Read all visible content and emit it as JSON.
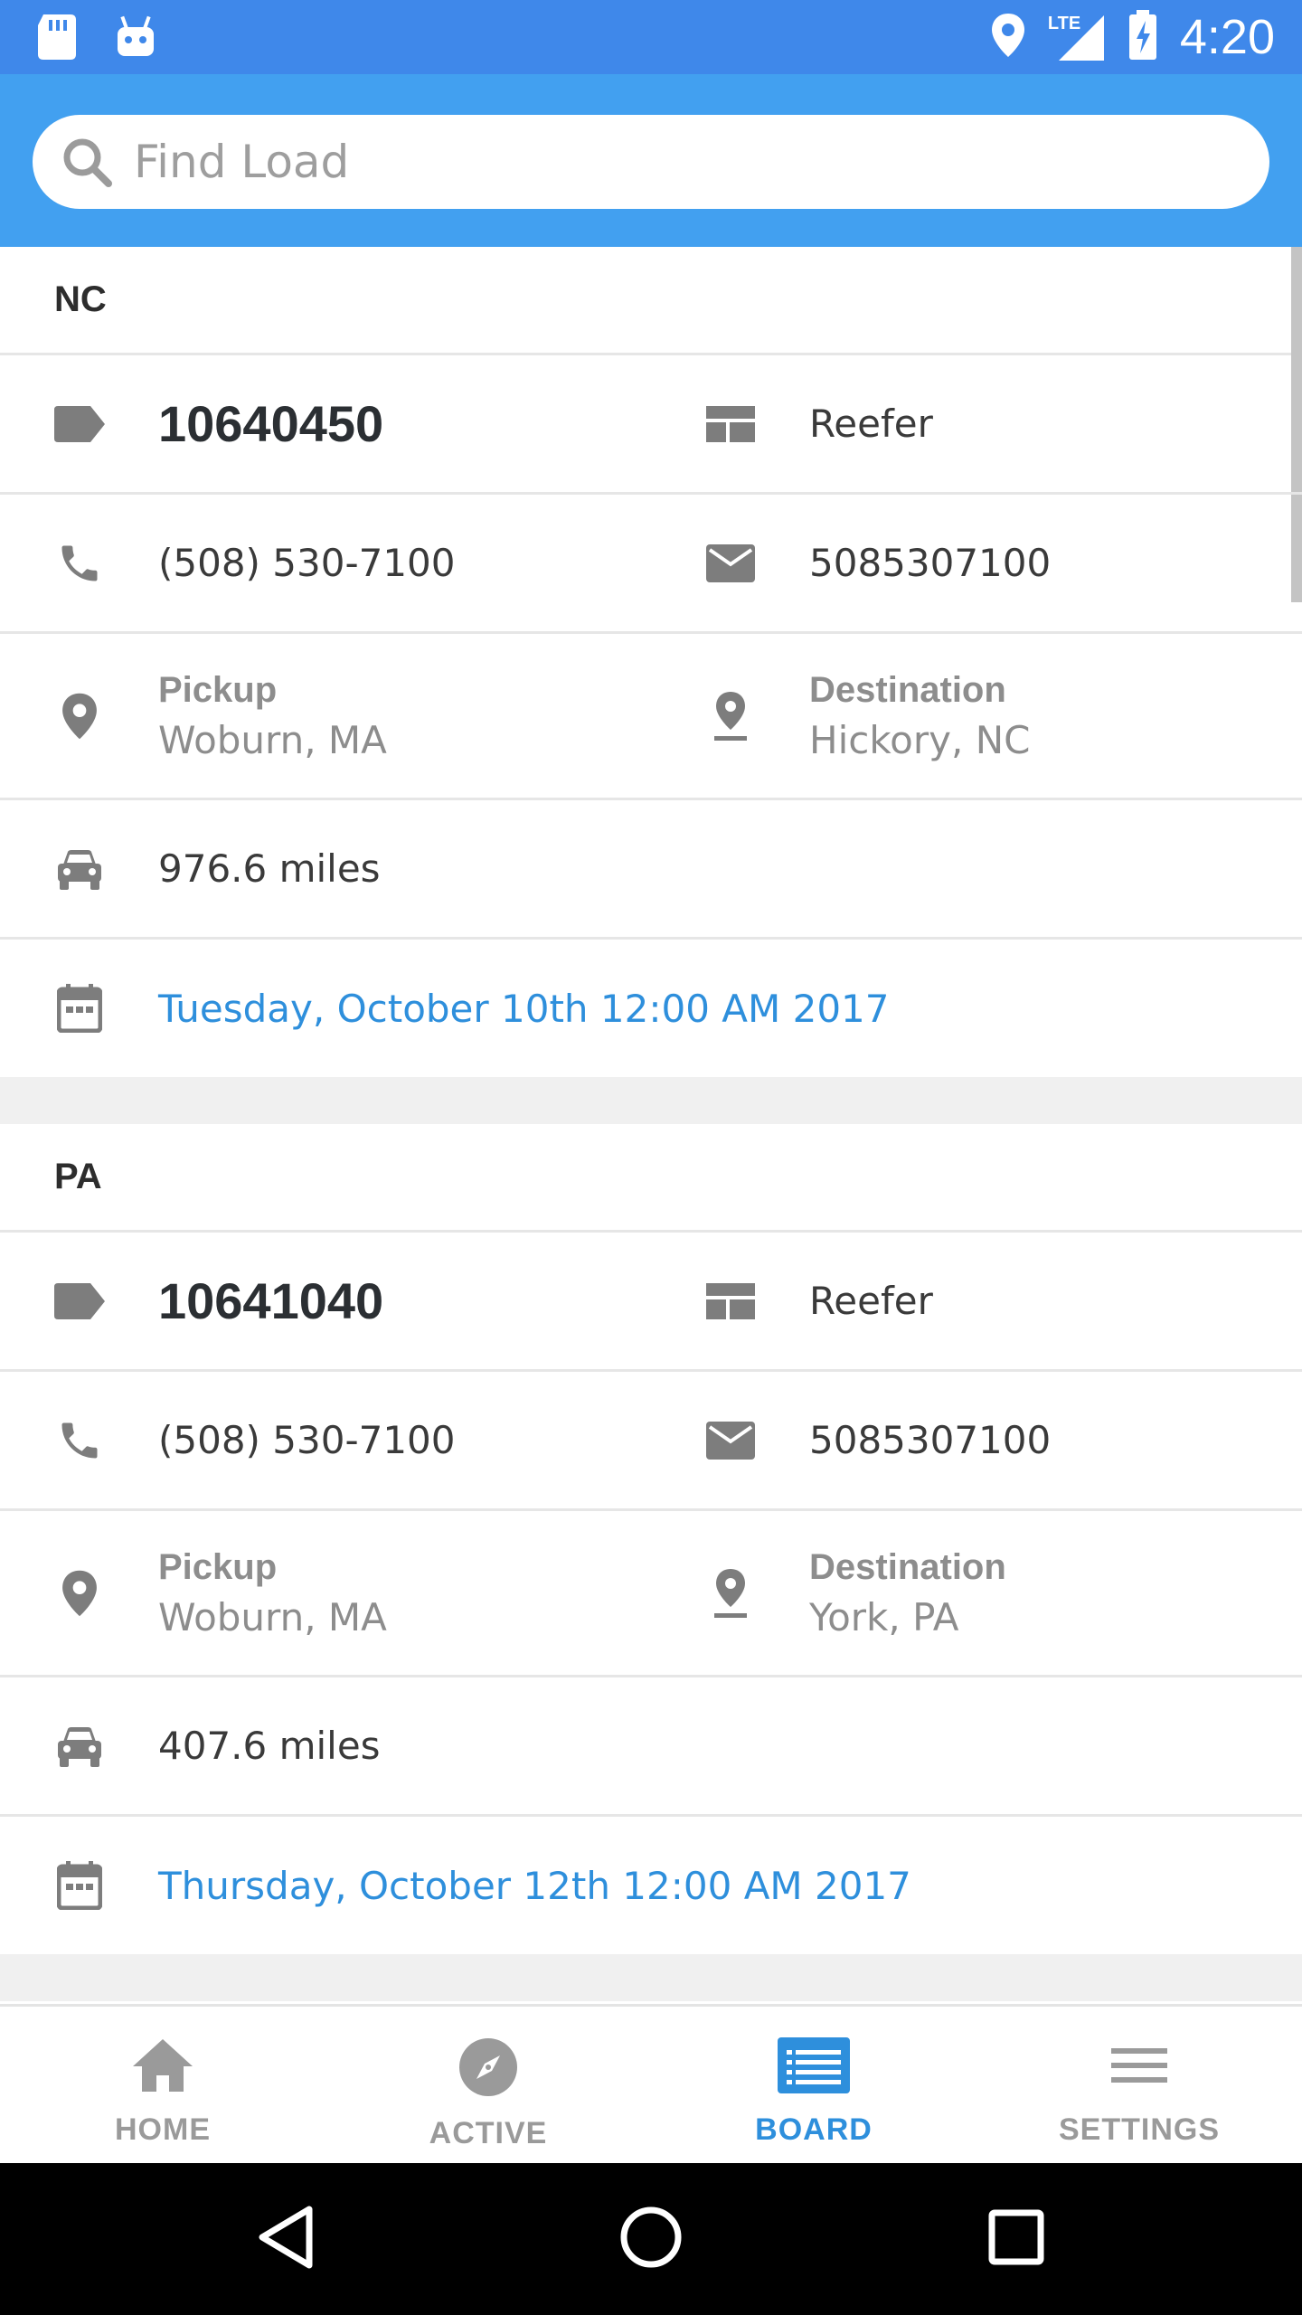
{
  "status_bar": {
    "time": "4:20",
    "network_label": "LTE",
    "icons": [
      "sd-card-icon",
      "android-icon",
      "location-icon",
      "signal-icon",
      "battery-charging-icon"
    ]
  },
  "search": {
    "placeholder": "Find Load",
    "value": ""
  },
  "loads": [
    {
      "state": "NC",
      "load_id": "10640450",
      "equipment": "Reefer",
      "phone": "(508) 530-7100",
      "contact": "5085307100",
      "pickup_label": "Pickup",
      "pickup": "Woburn, MA",
      "destination_label": "Destination",
      "destination": "Hickory, NC",
      "distance": "976.6 miles",
      "date": "Tuesday, October 10th 12:00 AM 2017"
    },
    {
      "state": "PA",
      "load_id": "10641040",
      "equipment": "Reefer",
      "phone": "(508) 530-7100",
      "contact": "5085307100",
      "pickup_label": "Pickup",
      "pickup": "Woburn, MA",
      "destination_label": "Destination",
      "destination": "York, PA",
      "distance": "407.6 miles",
      "date": "Thursday, October 12th 12:00 AM 2017"
    }
  ],
  "bottom_nav": {
    "items": [
      {
        "label": "HOME",
        "icon": "home-icon",
        "active": false
      },
      {
        "label": "ACTIVE",
        "icon": "compass-icon",
        "active": false
      },
      {
        "label": "BOARD",
        "icon": "board-icon",
        "active": true
      },
      {
        "label": "SETTINGS",
        "icon": "menu-icon",
        "active": false
      }
    ]
  },
  "colors": {
    "status_bar": "#3f88ea",
    "header": "#42a0f0",
    "accent": "#2e8fdc",
    "icon_gray": "#7d7d7d"
  }
}
